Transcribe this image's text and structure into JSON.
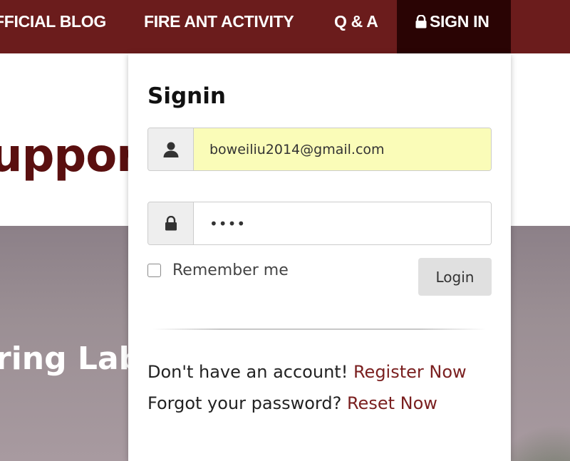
{
  "nav": {
    "items": [
      {
        "label": "FFICIAL BLOG"
      },
      {
        "label": "FIRE ANT ACTIVITY"
      },
      {
        "label": "Q & A"
      },
      {
        "label": "SIGN IN"
      }
    ]
  },
  "page": {
    "heading": "upport",
    "hero_text": "ring Labo"
  },
  "signin": {
    "title": "Signin",
    "email": {
      "value": "boweiliu2014@gmail.com",
      "icon": "user-icon"
    },
    "password": {
      "value": "••••",
      "icon": "lock-icon"
    },
    "remember_label": "Remember me",
    "login_label": "Login",
    "register_prompt": "Don't have an account!",
    "register_link": "Register Now",
    "forgot_prompt": "Forgot your password?",
    "reset_link": "Reset Now"
  },
  "colors": {
    "nav_bg": "#6b1c1c",
    "nav_active_bg": "#2a0404",
    "link": "#7a1f1f",
    "autofill_bg": "#fafcb8",
    "heading": "#5a0f0f"
  }
}
